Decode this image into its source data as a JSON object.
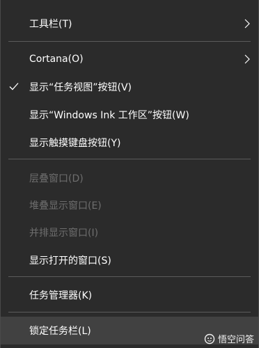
{
  "menu": {
    "items": [
      {
        "label": "工具栏(T)"
      },
      {
        "label": "Cortana(O)"
      },
      {
        "label": "显示“任务视图”按钮(V)"
      },
      {
        "label": "显示“Windows Ink 工作区”按钮(W)"
      },
      {
        "label": "显示触摸键盘按钮(Y)"
      },
      {
        "label": "层叠窗口(D)"
      },
      {
        "label": "堆叠显示窗口(E)"
      },
      {
        "label": "并排显示窗口(I)"
      },
      {
        "label": "显示打开的窗口(S)"
      },
      {
        "label": "任务管理器(K)"
      },
      {
        "label": "锁定任务栏(L)"
      }
    ]
  },
  "colors": {
    "background": "#2b2b2b",
    "text": "#ffffff",
    "disabled_text": "#6e6e6e",
    "separator": "#5c5c5c",
    "hover": "#414141"
  },
  "icons": {
    "checkmark": "checkmark-icon",
    "submenu": "chevron-right-icon",
    "watermark": "wukong-logo-icon"
  },
  "watermark": {
    "text": "悟空问答"
  }
}
